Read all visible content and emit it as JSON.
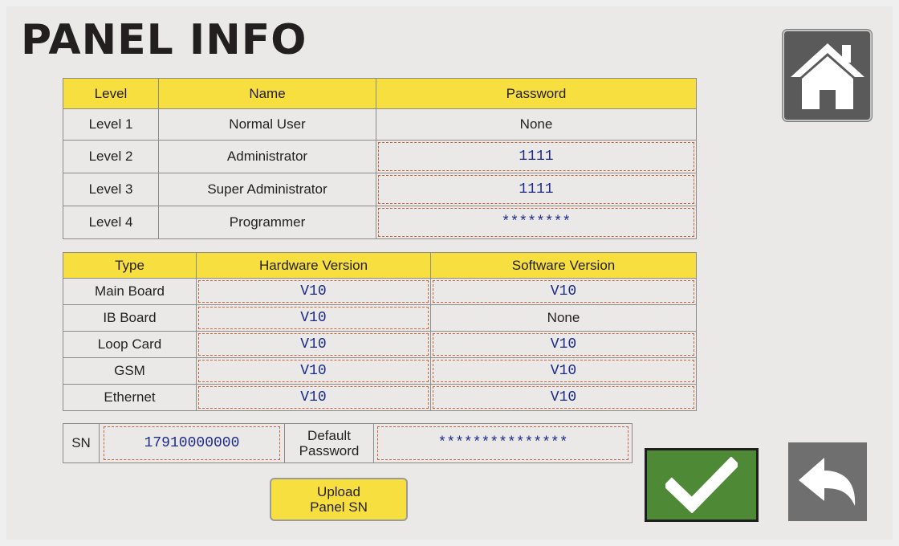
{
  "page": {
    "title": "PANEL INFO"
  },
  "users_table": {
    "headers": [
      "Level",
      "Name",
      "Password"
    ],
    "rows": [
      {
        "level": "Level 1",
        "name": "Normal User",
        "password": "None",
        "editable": false
      },
      {
        "level": "Level 2",
        "name": "Administrator",
        "password": "1111",
        "editable": true
      },
      {
        "level": "Level 3",
        "name": "Super Administrator",
        "password": "1111",
        "editable": true
      },
      {
        "level": "Level 4",
        "name": "Programmer",
        "password": "********",
        "editable": true
      }
    ]
  },
  "versions_table": {
    "headers": [
      "Type",
      "Hardware Version",
      "Software Version"
    ],
    "rows": [
      {
        "type": "Main Board",
        "hw": "V10",
        "sw": "V10",
        "sw_editable": true
      },
      {
        "type": "IB Board",
        "hw": "V10",
        "sw": "None",
        "sw_editable": false
      },
      {
        "type": "Loop Card",
        "hw": "V10",
        "sw": "V10",
        "sw_editable": true
      },
      {
        "type": "GSM",
        "hw": "V10",
        "sw": "V10",
        "sw_editable": true
      },
      {
        "type": "Ethernet",
        "hw": "V10",
        "sw": "V10",
        "sw_editable": true
      }
    ]
  },
  "sn_row": {
    "sn_label": "SN",
    "sn_value": "17910000000",
    "default_password_label_line1": "Default",
    "default_password_label_line2": "Password",
    "default_password_value": "***************"
  },
  "buttons": {
    "upload_line1": "Upload",
    "upload_line2": "Panel SN",
    "home_icon": "home-icon",
    "ok_icon": "checkmark-icon",
    "back_icon": "back-arrow-icon"
  },
  "colors": {
    "header_yellow": "#f7df3f",
    "ok_green": "#4e8a36",
    "field_border": "#c8623a",
    "value_text": "#1b2a8a"
  }
}
